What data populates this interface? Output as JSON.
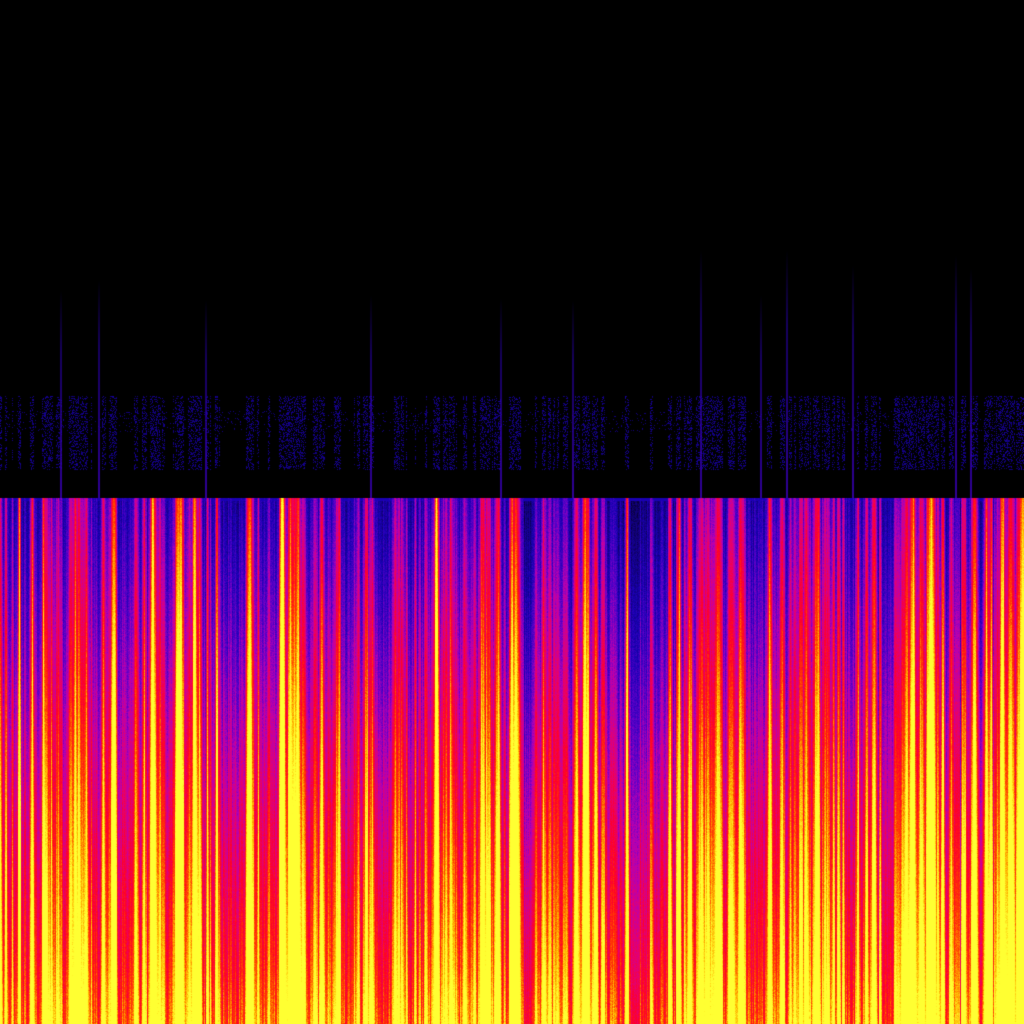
{
  "image": {
    "subject": "spectrogram",
    "colormap": [
      "#000000",
      "#10006e",
      "#1a00b4",
      "#5a00c8",
      "#b400b4",
      "#e6006e",
      "#ff0028",
      "#ff3c00",
      "#ffb400",
      "#ffff32"
    ],
    "background": "#000000",
    "axes_shown": false,
    "text_shown": false
  }
}
